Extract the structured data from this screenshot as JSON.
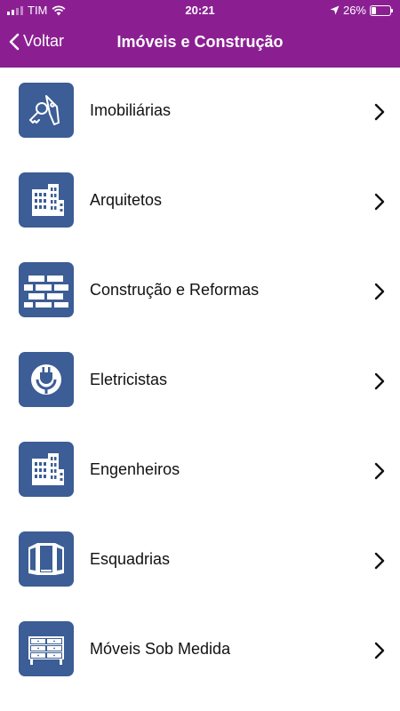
{
  "status_bar": {
    "carrier": "TIM",
    "time": "20:21",
    "battery": "26%",
    "battery_level": 0.26
  },
  "nav": {
    "back_label": "Voltar",
    "title": "Imóveis e Construção"
  },
  "items": [
    {
      "label": "Imobiliárias",
      "icon": "key-tag-icon"
    },
    {
      "label": "Arquitetos",
      "icon": "buildings-icon"
    },
    {
      "label": "Construção e Reformas",
      "icon": "bricks-icon"
    },
    {
      "label": "Eletricistas",
      "icon": "plug-icon"
    },
    {
      "label": "Engenheiros",
      "icon": "buildings-icon"
    },
    {
      "label": "Esquadrias",
      "icon": "window-icon"
    },
    {
      "label": "Móveis Sob Medida",
      "icon": "dresser-icon"
    }
  ],
  "colors": {
    "header": "#8b1f92",
    "icon_bg": "#3c5d95"
  }
}
